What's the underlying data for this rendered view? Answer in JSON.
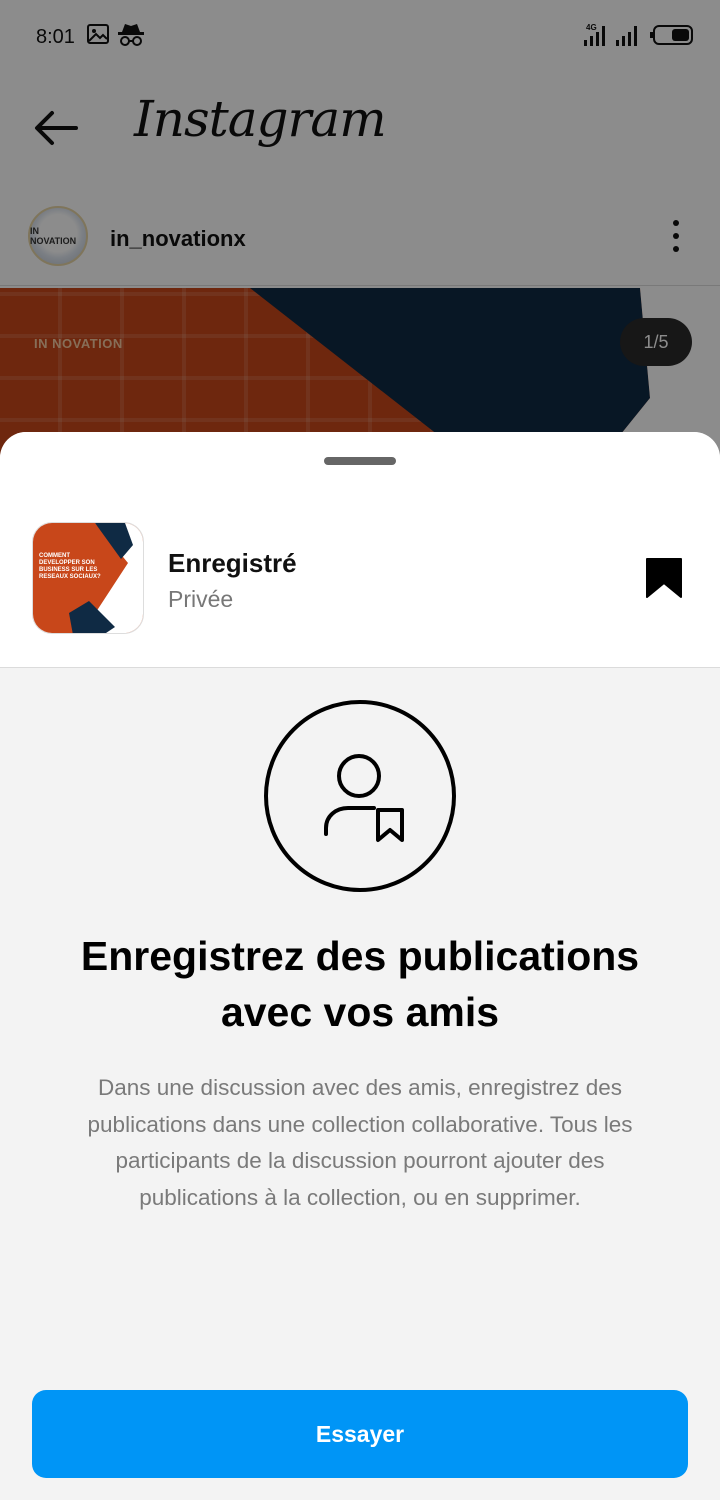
{
  "status_bar": {
    "time": "8:01",
    "network_label": "4G",
    "icons": [
      "gallery-icon",
      "incognito-icon",
      "signal-4g-icon",
      "signal-icon",
      "battery-icon"
    ]
  },
  "header": {
    "app_name": "Instagram",
    "back_icon": "back-arrow-icon"
  },
  "post": {
    "username": "in_novationx",
    "avatar_text": "IN NOVATION",
    "brand_text": "IN NOVATION",
    "image_counter": "1/5",
    "more_icon": "more-vertical-icon"
  },
  "sheet": {
    "collection": {
      "title": "Enregistré",
      "subtitle": "Privée",
      "thumbnail_text": "COMMENT DEVELOPPER SON BUSINESS SUR LES RESEAUX SOCIAUX?",
      "bookmark_icon": "bookmark-filled-icon"
    },
    "feature": {
      "icon": "person-bookmark-icon",
      "title": "Enregistrez des publications avec vos amis",
      "description": "Dans une discussion avec des amis, enregistrez des publications dans une collection collaborative. Tous les participants de la discussion pourront ajouter des publications à la collection, ou en supprimer."
    },
    "primary_button_label": "Essayer"
  },
  "colors": {
    "accent": "#0095f6",
    "post_orange": "#c8471a",
    "post_navy": "#0f2a44",
    "sheet_background": "#f3f3f3"
  }
}
